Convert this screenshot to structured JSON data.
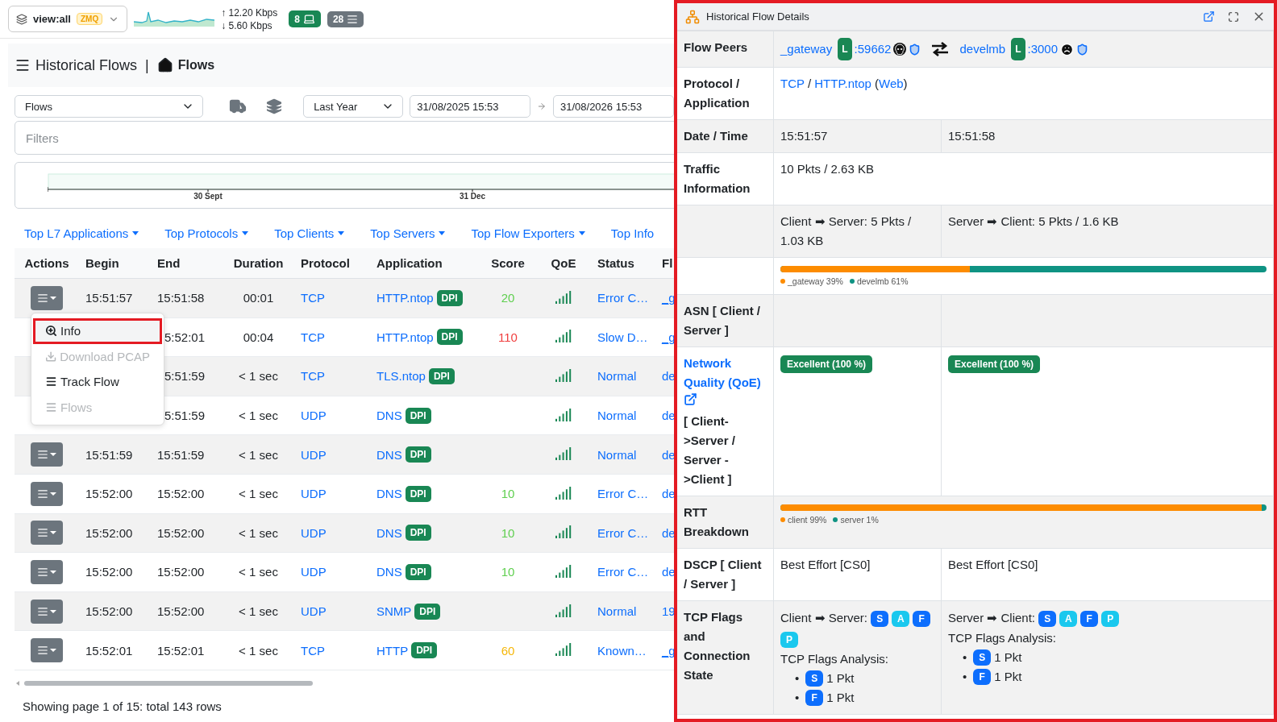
{
  "topbar": {
    "view": "view:all",
    "view_badge": "ZMQ",
    "upload": "↑ 12.20 Kbps",
    "download": "↓ 5.60 Kbps",
    "counters": [
      {
        "kind": "hosts",
        "value": "8",
        "color": "#198754"
      },
      {
        "kind": "flows",
        "value": "28",
        "color": "#6c757d"
      }
    ]
  },
  "breadcrumb": {
    "section": "Historical Flows",
    "separator": "|",
    "page": "Flows"
  },
  "toolbar": {
    "dataset": "Flows",
    "period": "Last Year",
    "date_from": "31/08/2025 15:53",
    "date_to": "31/08/2026 15:53"
  },
  "filters": {
    "placeholder": "Filters"
  },
  "timeline": {
    "ticks": [
      "30 Sept",
      "31 Dec"
    ]
  },
  "top_menus": [
    {
      "label": "Top L7 Applications",
      "caret": true
    },
    {
      "label": "Top Protocols",
      "caret": true
    },
    {
      "label": "Top Clients",
      "caret": true
    },
    {
      "label": "Top Servers",
      "caret": true
    },
    {
      "label": "Top Flow Exporters",
      "caret": true
    },
    {
      "label": "Top Info",
      "caret": false
    }
  ],
  "table": {
    "columns": [
      "Actions",
      "Begin",
      "End",
      "Duration",
      "Protocol",
      "Application",
      "Score",
      "QoE",
      "Status",
      "Fl"
    ],
    "rows": [
      {
        "covered": false,
        "begin": "15:51:57",
        "end": "15:51:58",
        "duration": "00:01",
        "protocol": "TCP",
        "application": "HTTP.ntop",
        "app_badge": "DPI",
        "score": {
          "text": "20",
          "color": "#5fcf4f"
        },
        "status": "Error C…",
        "flow": "_g",
        "flow_underlined": true
      },
      {
        "covered": true,
        "end": "5:52:01",
        "duration": "00:04",
        "protocol": "TCP",
        "application": "HTTP.ntop",
        "app_badge": "DPI",
        "score": {
          "text": "110",
          "color": "#f03e3e"
        },
        "status": "Slow D…",
        "flow": "_g",
        "flow_underlined": true
      },
      {
        "covered": true,
        "end": "5:51:59",
        "duration": "< 1 sec",
        "protocol": "TCP",
        "application": "TLS.ntop",
        "app_badge": "DPI",
        "status": "Normal",
        "flow": "de",
        "flow_underlined": false
      },
      {
        "covered": true,
        "end": "5:51:59",
        "duration": "< 1 sec",
        "protocol": "UDP",
        "application": "DNS",
        "app_badge": "DPI",
        "status": "Normal",
        "flow": "de",
        "flow_underlined": false
      },
      {
        "covered": false,
        "begin": "15:51:59",
        "end": "15:51:59",
        "duration": "< 1 sec",
        "protocol": "UDP",
        "application": "DNS",
        "app_badge": "DPI",
        "status": "Normal",
        "flow": "de",
        "flow_underlined": false
      },
      {
        "covered": false,
        "begin": "15:52:00",
        "end": "15:52:00",
        "duration": "< 1 sec",
        "protocol": "UDP",
        "application": "DNS",
        "app_badge": "DPI",
        "score": {
          "text": "10",
          "color": "#5fcf4f"
        },
        "status": "Error C…",
        "flow": "de",
        "flow_underlined": false
      },
      {
        "covered": false,
        "begin": "15:52:00",
        "end": "15:52:00",
        "duration": "< 1 sec",
        "protocol": "UDP",
        "application": "DNS",
        "app_badge": "DPI",
        "score": {
          "text": "10",
          "color": "#5fcf4f"
        },
        "status": "Error C…",
        "flow": "de",
        "flow_underlined": false
      },
      {
        "covered": false,
        "begin": "15:52:00",
        "end": "15:52:00",
        "duration": "< 1 sec",
        "protocol": "UDP",
        "application": "DNS",
        "app_badge": "DPI",
        "score": {
          "text": "10",
          "color": "#5fcf4f"
        },
        "status": "Error C…",
        "flow": "de",
        "flow_underlined": false
      },
      {
        "covered": false,
        "begin": "15:52:00",
        "end": "15:52:00",
        "duration": "< 1 sec",
        "protocol": "UDP",
        "application": "SNMP",
        "app_badge": "DPI",
        "status": "Normal",
        "flow": "19",
        "flow_underlined": false
      },
      {
        "covered": false,
        "begin": "15:52:01",
        "end": "15:52:01",
        "duration": "< 1 sec",
        "protocol": "TCP",
        "application": "HTTP",
        "app_badge": "DPI",
        "score": {
          "text": "60",
          "color": "#f5b70a"
        },
        "status": "Known…",
        "flow": "_g",
        "flow_underlined": true
      }
    ]
  },
  "actions_menu": [
    {
      "kind": "info",
      "label": "Info",
      "selected": true,
      "disabled": false
    },
    {
      "kind": "download",
      "label": "Download PCAP",
      "selected": false,
      "disabled": true
    },
    {
      "kind": "list",
      "label": "Track Flow",
      "selected": false,
      "disabled": false
    },
    {
      "kind": "list",
      "label": "Flows",
      "selected": false,
      "disabled": true
    }
  ],
  "footer": "Showing page 1 of 15: total 143 rows",
  "details": {
    "title": "Historical Flow Details",
    "rows": [
      {
        "kind": "peers",
        "label": "Flow Peers",
        "peers": [
          {
            "kind": "skull",
            "name": "_gateway",
            "badge": "L",
            "port": ":59662"
          },
          {
            "kind": "sad",
            "name": "develmb",
            "badge": "L",
            "port": ":3000"
          }
        ]
      },
      {
        "kind": "parts",
        "label": "Protocol / Application",
        "parts": [
          {
            "text": "TCP",
            "link": true
          },
          {
            "text": " / ",
            "link": false
          },
          {
            "text": "HTTP.ntop",
            "link": true
          },
          {
            "text": " (",
            "link": false
          },
          {
            "text": "Web",
            "link": true
          },
          {
            "text": ")",
            "link": false
          }
        ]
      },
      {
        "kind": "split",
        "label": "Date / Time",
        "cells": [
          "15:51:57",
          "15:51:58"
        ]
      },
      {
        "kind": "single",
        "label": "Traffic Information",
        "text": "10 Pkts / 2.63 KB"
      },
      {
        "kind": "split",
        "cells": [
          "Client ➡ Server: 5 Pkts / 1.03 KB",
          "Server ➡ Client: 5 Pkts / 1.6 KB"
        ]
      },
      {
        "kind": "bar",
        "segments": [
          {
            "legend": "_gateway 39%",
            "level": 0.39,
            "color": "#fd8c00"
          },
          {
            "legend": "develmb 61%",
            "color": "#0f9383"
          }
        ]
      },
      {
        "kind": "blank",
        "label": "ASN [ Client / Server ]"
      },
      {
        "kind": "badges",
        "label_link": "Network Quality (QoE)",
        "label": "[ Client->Server / Server ->Client ]",
        "cells": [
          "Excellent (100 %)",
          "Excellent (100 %)"
        ]
      },
      {
        "kind": "bar",
        "label": "RTT Breakdown",
        "segments": [
          {
            "legend": "client 99%",
            "level": 0.99,
            "color": "#fd8c00"
          },
          {
            "legend": "server 1%",
            "color": "#0f9383"
          }
        ]
      },
      {
        "kind": "split",
        "label": "DSCP [ Client / Server ]",
        "cells": [
          "Best Effort [CS0]",
          "Best Effort [CS0]"
        ]
      },
      {
        "kind": "flags",
        "label": "TCP Flags and Connection State",
        "cells": [
          {
            "heading": "Client ➡ Server:",
            "flags": [
              {
                "letter": "S",
                "color": "#0d6efd"
              },
              {
                "letter": "A",
                "color": "#1ac8ee"
              },
              {
                "letter": "F",
                "color": "#0d6efd"
              },
              {
                "letter": "P",
                "color": "#1ac8ee"
              }
            ],
            "analysis_title": "TCP Flags Analysis:",
            "analysis": [
              {
                "bullet": "•",
                "letter": "S",
                "color": "#0d6efd",
                "text": "1 Pkt"
              },
              {
                "bullet": "•",
                "letter": "F",
                "color": "#0d6efd",
                "text": "1 Pkt"
              }
            ]
          },
          {
            "heading": "Server ➡ Client:",
            "flags": [
              {
                "letter": "S",
                "color": "#0d6efd"
              },
              {
                "letter": "A",
                "color": "#1ac8ee"
              },
              {
                "letter": "F",
                "color": "#0d6efd"
              },
              {
                "letter": "P",
                "color": "#1ac8ee"
              }
            ],
            "analysis_title": "TCP Flags Analysis:",
            "analysis": [
              {
                "bullet": "•",
                "letter": "S",
                "color": "#0d6efd",
                "text": "1 Pkt"
              },
              {
                "bullet": "•",
                "letter": "F",
                "color": "#0d6efd",
                "text": "1 Pkt"
              }
            ]
          }
        ]
      }
    ]
  }
}
